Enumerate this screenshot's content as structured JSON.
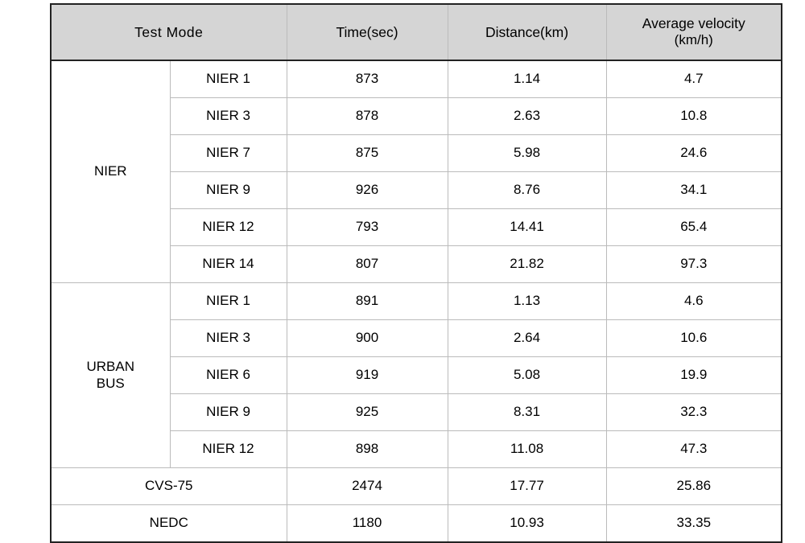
{
  "table": {
    "headers": {
      "mode": "Test  Mode",
      "time": "Time(sec)",
      "distance": "Distance(km)",
      "velocity_line1": "Average velocity",
      "velocity_line2": "(km/h)"
    },
    "groups": [
      {
        "name": "NIER",
        "rows": [
          {
            "sub": "NIER 1",
            "time": "873",
            "distance": "1.14",
            "velocity": "4.7"
          },
          {
            "sub": "NIER 3",
            "time": "878",
            "distance": "2.63",
            "velocity": "10.8"
          },
          {
            "sub": "NIER 7",
            "time": "875",
            "distance": "5.98",
            "velocity": "24.6"
          },
          {
            "sub": "NIER 9",
            "time": "926",
            "distance": "8.76",
            "velocity": "34.1"
          },
          {
            "sub": "NIER 12",
            "time": "793",
            "distance": "14.41",
            "velocity": "65.4"
          },
          {
            "sub": "NIER 14",
            "time": "807",
            "distance": "21.82",
            "velocity": "97.3"
          }
        ]
      },
      {
        "name_line1": "URBAN",
        "name_line2": "BUS",
        "rows": [
          {
            "sub": "NIER 1",
            "time": "891",
            "distance": "1.13",
            "velocity": "4.6"
          },
          {
            "sub": "NIER 3",
            "time": "900",
            "distance": "2.64",
            "velocity": "10.6"
          },
          {
            "sub": "NIER 6",
            "time": "919",
            "distance": "5.08",
            "velocity": "19.9"
          },
          {
            "sub": "NIER 9",
            "time": "925",
            "distance": "8.31",
            "velocity": "32.3"
          },
          {
            "sub": "NIER 12",
            "time": "898",
            "distance": "11.08",
            "velocity": "47.3"
          }
        ]
      }
    ],
    "single_rows": [
      {
        "label": "CVS-75",
        "time": "2474",
        "distance": "17.77",
        "velocity": "25.86"
      },
      {
        "label": "NEDC",
        "time": "1180",
        "distance": "10.93",
        "velocity": "33.35"
      }
    ]
  }
}
